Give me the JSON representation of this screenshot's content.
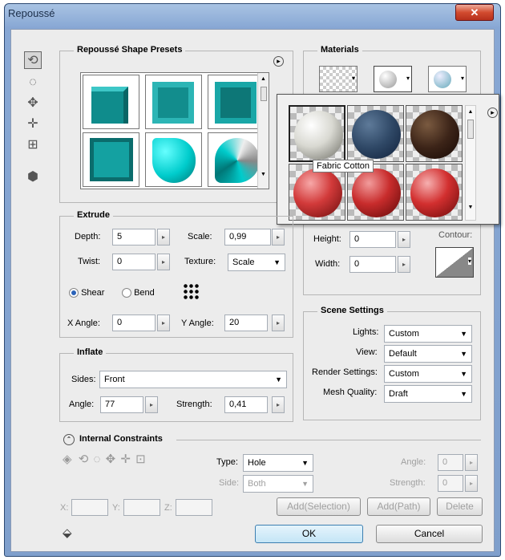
{
  "window": {
    "title": "Repoussé",
    "close_glyph": "✕"
  },
  "presets": {
    "title": "Repoussé Shape Presets",
    "menu_glyph": "▸"
  },
  "materials": {
    "title": "Materials",
    "menu_glyph": "▸",
    "tooltip": "Fabric Cotton"
  },
  "extrude": {
    "title": "Extrude",
    "depth_label": "Depth:",
    "depth_value": "5",
    "scale_label": "Scale:",
    "scale_value": "0,99",
    "twist_label": "Twist:",
    "twist_value": "0",
    "texture_label": "Texture:",
    "texture_value": "Scale",
    "shear_label": "Shear",
    "bend_label": "Bend",
    "xangle_label": "X Angle:",
    "xangle_value": "0",
    "yangle_label": "Y Angle:",
    "yangle_value": "20"
  },
  "bevel": {
    "height_label": "Height:",
    "height_value": "0",
    "width_label": "Width:",
    "width_value": "0",
    "contour_label": "Contour:"
  },
  "inflate": {
    "title": "Inflate",
    "sides_label": "Sides:",
    "sides_value": "Front",
    "angle_label": "Angle:",
    "angle_value": "77",
    "strength_label": "Strength:",
    "strength_value": "0,41"
  },
  "scene": {
    "title": "Scene Settings",
    "lights_label": "Lights:",
    "lights_value": "Custom",
    "view_label": "View:",
    "view_value": "Default",
    "render_label": "Render Settings:",
    "render_value": "Custom",
    "mesh_label": "Mesh Quality:",
    "mesh_value": "Draft"
  },
  "constraints": {
    "title": "Internal Constraints",
    "type_label": "Type:",
    "type_value": "Hole",
    "side_label": "Side:",
    "side_value": "Both",
    "angle_label": "Angle:",
    "angle_value": "0",
    "strength_label": "Strength:",
    "strength_value": "0",
    "x_label": "X:",
    "y_label": "Y:",
    "z_label": "Z:",
    "add_selection": "Add(Selection)",
    "add_path": "Add(Path)",
    "delete": "Delete"
  },
  "footer": {
    "ok": "OK",
    "cancel": "Cancel"
  }
}
